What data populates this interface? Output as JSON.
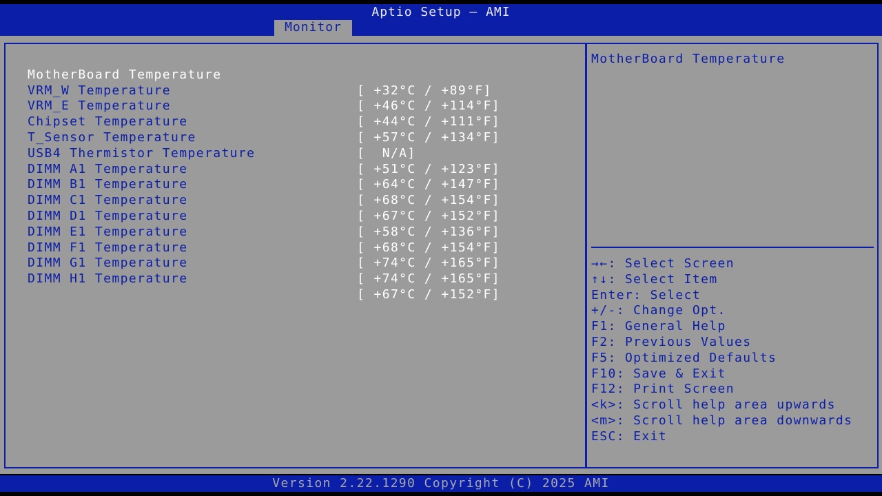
{
  "header": {
    "title": "Aptio Setup – AMI",
    "active_tab": "Monitor"
  },
  "colors": {
    "accent": "#0b1ea8",
    "panel": "#9b9b9b",
    "highlight": "#ffffff"
  },
  "items": [
    {
      "label": "MotherBoard Temperature",
      "value": "[ +32°C / +89°F]"
    },
    {
      "label": "VRM_W Temperature",
      "value": "[ +46°C / +114°F]"
    },
    {
      "label": "VRM_E Temperature",
      "value": "[ +44°C / +111°F]"
    },
    {
      "label": "Chipset Temperature",
      "value": "[ +57°C / +134°F]"
    },
    {
      "label": "T_Sensor Temperature",
      "value": "[  N/A]"
    },
    {
      "label": "USB4 Thermistor Temperature",
      "value": "[ +51°C / +123°F]"
    },
    {
      "label": "DIMM A1 Temperature",
      "value": "[ +64°C / +147°F]"
    },
    {
      "label": "DIMM B1 Temperature",
      "value": "[ +68°C / +154°F]"
    },
    {
      "label": "DIMM C1 Temperature",
      "value": "[ +67°C / +152°F]"
    },
    {
      "label": "DIMM D1 Temperature",
      "value": "[ +58°C / +136°F]"
    },
    {
      "label": "DIMM E1 Temperature",
      "value": "[ +68°C / +154°F]"
    },
    {
      "label": "DIMM F1 Temperature",
      "value": "[ +74°C / +165°F]"
    },
    {
      "label": "DIMM G1 Temperature",
      "value": "[ +74°C / +165°F]"
    },
    {
      "label": "DIMM H1 Temperature",
      "value": "[ +67°C / +152°F]"
    }
  ],
  "help": {
    "title": "MotherBoard Temperature",
    "keys": [
      "→←: Select Screen",
      "↑↓: Select Item",
      "Enter: Select",
      "+/-: Change Opt.",
      "F1: General Help",
      "F2: Previous Values",
      "F5: Optimized Defaults",
      "F10: Save & Exit",
      "F12: Print Screen",
      "<k>: Scroll help area upwards",
      "<m>: Scroll help area downwards",
      "ESC: Exit"
    ]
  },
  "footer": {
    "version": "Version 2.22.1290 Copyright (C) 2025 AMI"
  }
}
